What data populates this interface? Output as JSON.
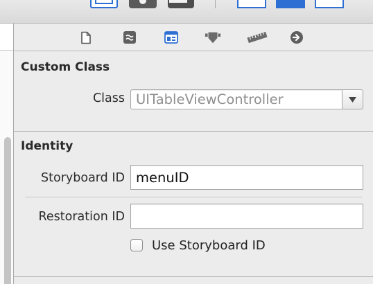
{
  "toolbar": {
    "buttons": [
      "standard-editor",
      "assistant-editor",
      "version-editor"
    ],
    "view_buttons": [
      "navigator",
      "debug-area",
      "utilities"
    ]
  },
  "inspector": {
    "tabs": [
      {
        "name": "file-inspector",
        "icon": "file-icon",
        "selected": false
      },
      {
        "name": "quick-help",
        "icon": "quick-help-icon",
        "selected": false
      },
      {
        "name": "identity-inspector",
        "icon": "identity-icon",
        "selected": true
      },
      {
        "name": "attributes-inspector",
        "icon": "attributes-icon",
        "selected": false
      },
      {
        "name": "size-inspector",
        "icon": "ruler-icon",
        "selected": false
      },
      {
        "name": "connections-inspector",
        "icon": "arrow-circle-icon",
        "selected": false
      }
    ],
    "custom_class": {
      "title": "Custom Class",
      "class_label": "Class",
      "class_placeholder": "UITableViewController"
    },
    "identity": {
      "title": "Identity",
      "storyboard_id_label": "Storyboard ID",
      "storyboard_id_value": "menuID",
      "restoration_id_label": "Restoration ID",
      "restoration_id_value": "",
      "use_storyboard_id_label": "Use Storyboard ID",
      "use_storyboard_id_checked": false
    }
  },
  "colors": {
    "accent": "#2d6fd2",
    "icon_gray": "#6b6b6b"
  }
}
